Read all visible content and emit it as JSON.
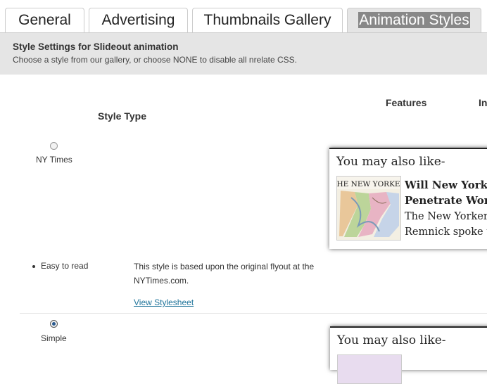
{
  "tabs": [
    {
      "label": "General"
    },
    {
      "label": "Advertising"
    },
    {
      "label": "Thumbnails Gallery"
    },
    {
      "label": "Animation Styles"
    }
  ],
  "header": {
    "title": "Style Settings for Slideout animation",
    "subtitle": "Choose a style from our gallery, or choose NONE to disable all nrelate CSS."
  },
  "columns": {
    "style_type": "Style Type",
    "features": "Features",
    "partial": "In"
  },
  "styles": [
    {
      "name": "NY Times",
      "selected": false,
      "feature": "Easy to read",
      "description": "This style is based upon the original flyout at the NYTimes.com.",
      "link": "View Stylesheet",
      "preview": {
        "heading": "You may also like-",
        "thumb_text": "THE NEW YORKER",
        "article_title_l1": "Will New York",
        "article_title_l2": "Penetrate Wor",
        "article_text_l1": "The New Yorker",
        "article_text_l2": "Remnick spoke t"
      }
    },
    {
      "name": "Simple",
      "selected": true,
      "preview": {
        "heading": "You may also like-"
      }
    }
  ]
}
